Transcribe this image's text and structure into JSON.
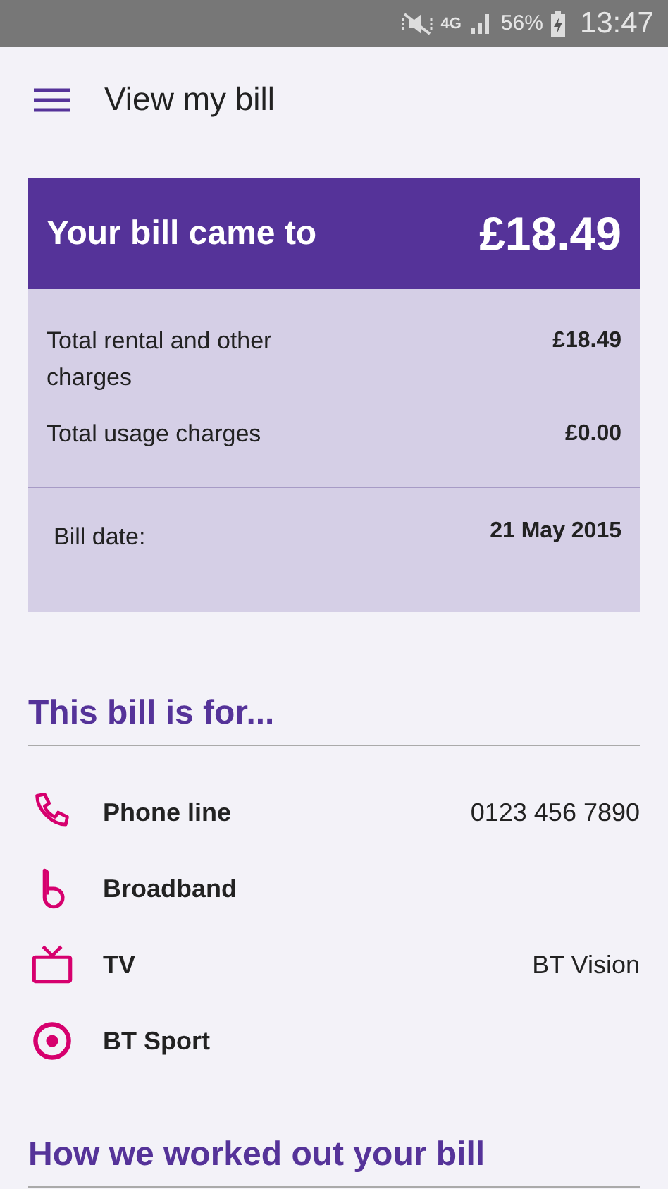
{
  "status_bar": {
    "network": "4G",
    "battery": "56%",
    "time": "13:47"
  },
  "app_bar": {
    "title": "View my bill"
  },
  "bill": {
    "heading": "Your bill came to",
    "total": "£18.49",
    "charges": [
      {
        "label": "Total rental and other charges",
        "amount": "£18.49"
      },
      {
        "label": "Total usage charges",
        "amount": "£0.00"
      }
    ],
    "date_label": "Bill date:",
    "date": "21 May 2015"
  },
  "services_section": {
    "heading": "This bill is for...",
    "items": [
      {
        "kind": "phone",
        "name": "Phone line",
        "detail": "0123 456 7890"
      },
      {
        "kind": "broadband",
        "name": "Broadband"
      },
      {
        "kind": "tv",
        "name": "TV",
        "detail": "BT Vision"
      },
      {
        "kind": "sport",
        "name": "BT Sport"
      }
    ]
  },
  "next_section": {
    "heading": "How we worked out your bill"
  }
}
